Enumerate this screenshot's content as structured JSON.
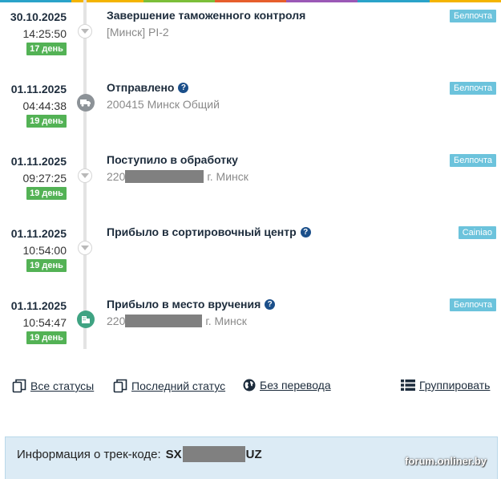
{
  "topbar_colors": [
    "#2aa3c9",
    "#f4b400",
    "#7cbf3a",
    "#e65e2c",
    "#9b59b6",
    "#2aa3c9",
    "#f4b400"
  ],
  "events": [
    {
      "date": "30.10.2025",
      "time": "14:25:50",
      "day": "17 день",
      "title": "Завершение таможенного контроля",
      "has_help": false,
      "location": "[Минск] PI-2",
      "location_prefix": "",
      "location_suffix": "",
      "redacted": false,
      "carrier": "Белпочта",
      "icon": "chevron-down-icon"
    },
    {
      "date": "01.11.2025",
      "time": "04:44:38",
      "day": "19 день",
      "title": "Отправлено",
      "has_help": true,
      "location": "200415 Минск Общий",
      "location_prefix": "",
      "location_suffix": "",
      "redacted": false,
      "carrier": "Белпочта",
      "icon": "truck-icon"
    },
    {
      "date": "01.11.2025",
      "time": "09:27:25",
      "day": "19 день",
      "title": "Поступило в обработку",
      "has_help": false,
      "location": "",
      "location_prefix": "220",
      "location_suffix": "г. Минск",
      "redacted": true,
      "carrier": "Белпочта",
      "icon": "chevron-down-icon"
    },
    {
      "date": "01.11.2025",
      "time": "10:54:00",
      "day": "19 день",
      "title": "Прибыло в сортировочный центр",
      "has_help": true,
      "location": "",
      "location_prefix": "",
      "location_suffix": "",
      "redacted": false,
      "carrier": "Cainiao",
      "icon": "chevron-down-icon"
    },
    {
      "date": "01.11.2025",
      "time": "10:54:47",
      "day": "19 день",
      "title": "Прибыло в место вручения",
      "has_help": true,
      "location": "",
      "location_prefix": "220",
      "location_suffix": "г. Минск",
      "redacted": true,
      "carrier": "Белпочта",
      "icon": "building-icon"
    }
  ],
  "actions": {
    "all_statuses": "Все статусы",
    "last_status": "Последний статус",
    "no_translation": "Без перевода",
    "group": "Группировать"
  },
  "info": {
    "label": "Информация о трек-коде:",
    "code_prefix": "SX",
    "code_suffix": "UZ"
  },
  "watermark": "forum.onliner.by",
  "colors": {
    "day_badge": "#53b255",
    "carrier_badge": "#6cc3dc",
    "help_icon": "#1b4f8a",
    "info_panel": "#dcebf5"
  }
}
